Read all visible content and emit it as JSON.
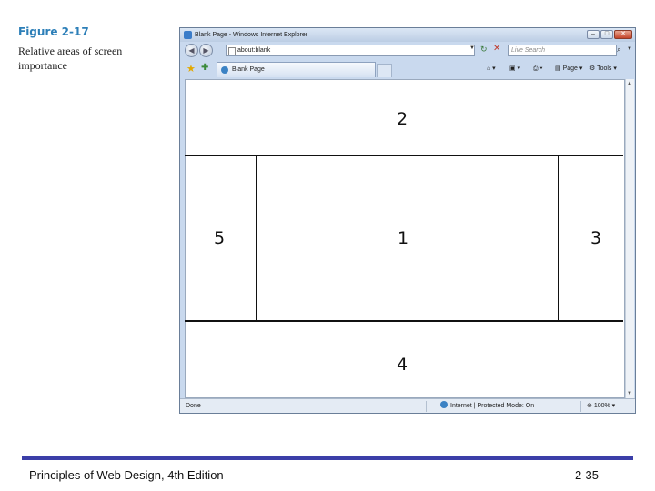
{
  "figure": {
    "label": "Figure 2-17",
    "caption": "Relative areas of screen importance"
  },
  "browser": {
    "title": "Blank Page - Windows Internet Explorer",
    "address": "about:blank",
    "search_placeholder": "Live Search",
    "tab_label": "Blank Page",
    "commands": {
      "page": "Page",
      "tools": "Tools"
    },
    "status": {
      "left": "Done",
      "zone": "Internet | Protected Mode: On",
      "zoom": "100%"
    }
  },
  "zones": {
    "center": "1",
    "top": "2",
    "right": "3",
    "bottom": "4",
    "left": "5"
  },
  "footer": {
    "title": "Principles of Web Design, 4th Edition",
    "page": "2-35"
  }
}
